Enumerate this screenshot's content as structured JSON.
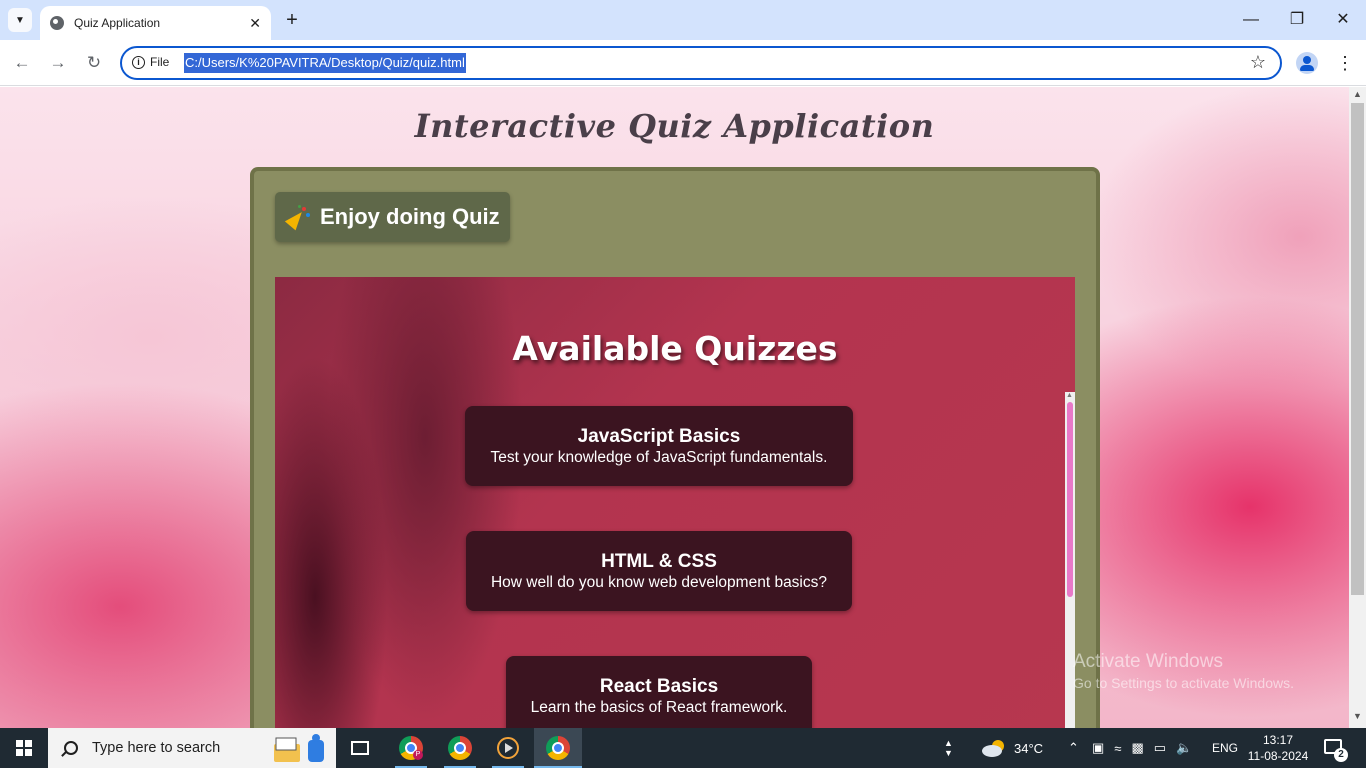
{
  "browser": {
    "tab_title": "Quiz Application",
    "file_chip": "File",
    "url": "C:/Users/K%20PAVITRA/Desktop/Quiz/quiz.html"
  },
  "page": {
    "heading": "Interactive Quiz Application",
    "enjoy_label": "Enjoy doing Quiz",
    "section_title": "Available Quizzes",
    "quizzes": [
      {
        "title": "JavaScript Basics",
        "description": "Test your knowledge of JavaScript fundamentals."
      },
      {
        "title": "HTML & CSS",
        "description": "How well do you know web development basics?"
      },
      {
        "title": "React Basics",
        "description": "Learn the basics of React framework."
      }
    ],
    "watermark": {
      "line1": "Activate Windows",
      "line2": "Go to Settings to activate Windows."
    }
  },
  "taskbar": {
    "search_placeholder": "Type here to search",
    "weather": "34°C",
    "language": "ENG",
    "time": "13:17",
    "date": "11-08-2024",
    "notifications": "2"
  },
  "colors": {
    "panel": "#8b8e62",
    "quiz_card": "#3b1420",
    "accent_blue": "#0b57d0"
  }
}
